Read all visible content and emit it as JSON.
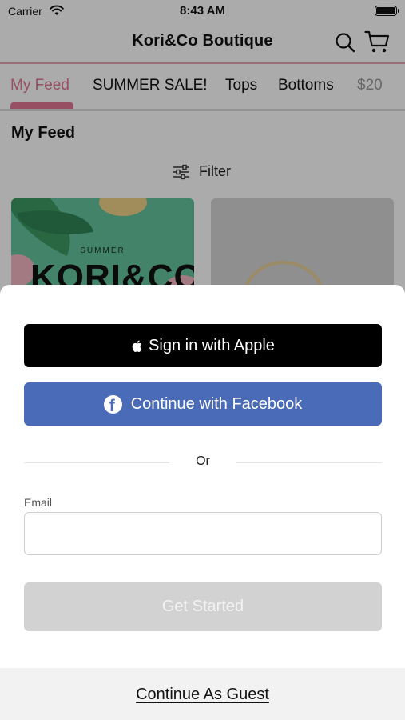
{
  "status_bar": {
    "carrier": "Carrier",
    "time": "8:43 AM"
  },
  "nav": {
    "title": "Kori&Co Boutique"
  },
  "tabs": [
    {
      "label": "My Feed",
      "active": true
    },
    {
      "label": "SUMMER SALE!"
    },
    {
      "label": "Tops"
    },
    {
      "label": "Bottoms"
    },
    {
      "label": "$20"
    }
  ],
  "feed": {
    "section_title": "My Feed",
    "filter_label": "Filter",
    "card_1": {
      "caption": "SUMMER",
      "brand": "KORI&CO"
    }
  },
  "sheet": {
    "apple_label": "Sign in with Apple",
    "facebook_label": "Continue with Facebook",
    "or_label": "Or",
    "email_label": "Email",
    "email_value": "",
    "start_label": "Get Started",
    "guest_label": "Continue As Guest"
  },
  "colors": {
    "accent_pink": "#e07794",
    "facebook_blue": "#4a6bb8",
    "apple_black": "#000000",
    "disabled_gray": "#d2d2d2"
  }
}
